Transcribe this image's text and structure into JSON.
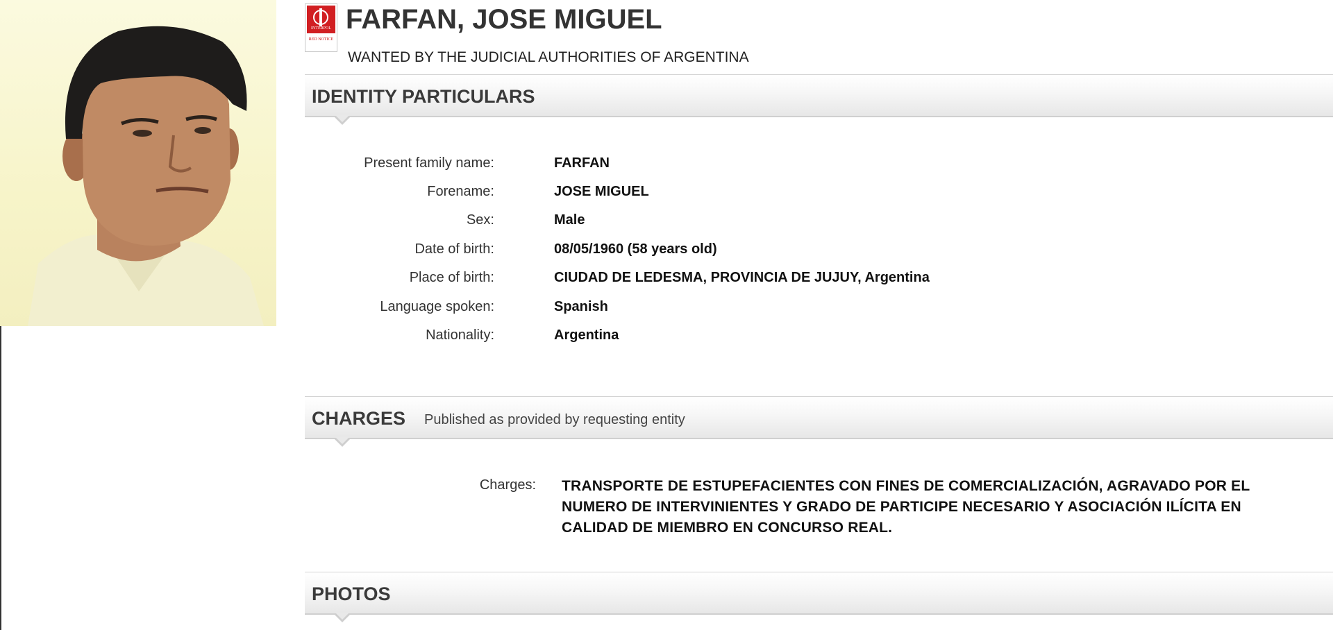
{
  "notice": {
    "logo_text": "INTERPOL",
    "logo_sub": "RED NOTICE",
    "name": "FARFAN, JOSE MIGUEL",
    "wanted_by": "WANTED BY THE JUDICIAL AUTHORITIES OF ARGENTINA"
  },
  "identity": {
    "heading": "IDENTITY PARTICULARS",
    "rows": [
      {
        "label": "Present family name:",
        "value": "FARFAN"
      },
      {
        "label": "Forename:",
        "value": "JOSE MIGUEL"
      },
      {
        "label": "Sex:",
        "value": "Male"
      },
      {
        "label": "Date of birth:",
        "value": "08/05/1960 (58 years old)"
      },
      {
        "label": "Place of birth:",
        "value": "CIUDAD DE LEDESMA, PROVINCIA DE JUJUY, Argentina"
      },
      {
        "label": "Language spoken:",
        "value": "Spanish"
      },
      {
        "label": "Nationality:",
        "value": "Argentina"
      }
    ]
  },
  "charges": {
    "heading": "CHARGES",
    "note": "Published as provided by requesting entity",
    "label": "Charges:",
    "text": "TRANSPORTE DE ESTUPEFACIENTES CON FINES DE COMERCIALIZACIÓN, AGRAVADO POR EL NUMERO DE INTERVINIENTES Y GRADO DE PARTICIPE NECESARIO Y ASOCIACIÓN ILÍCITA EN CALIDAD DE MIEMBRO EN CONCURSO REAL."
  },
  "photos": {
    "heading": "PHOTOS"
  },
  "colors": {
    "logo_red": "#d11f22",
    "header_gray": "#e7e7e7",
    "photo_bg": "#f7f4c9"
  }
}
